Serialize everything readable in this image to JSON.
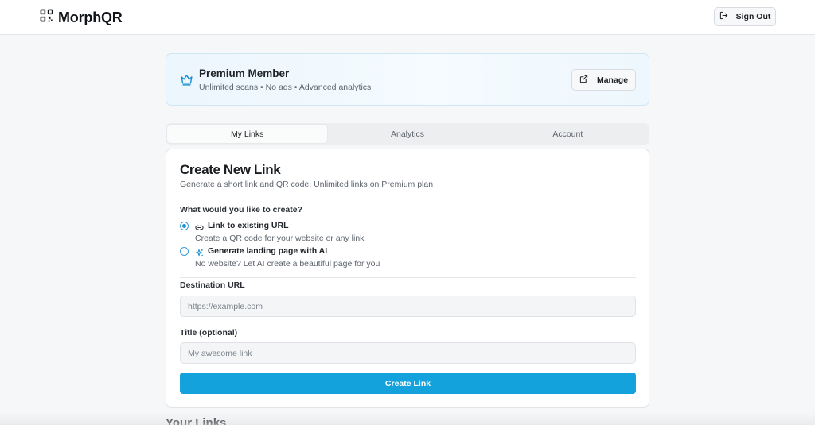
{
  "header": {
    "brand": "MorphQR",
    "brand_icon": "qr-code-icon",
    "signout_label": "Sign Out",
    "signout_icon": "log-out-icon"
  },
  "premium": {
    "title": "Premium Member",
    "subtitle": "Unlimited scans • No ads • Advanced analytics",
    "icon": "crown-icon",
    "manage_label": "Manage",
    "manage_icon": "external-link-icon",
    "accent_color": "#1b8fcf"
  },
  "tabs": [
    {
      "label": "My Links",
      "active": true
    },
    {
      "label": "Analytics",
      "active": false
    },
    {
      "label": "Account",
      "active": false
    }
  ],
  "form": {
    "title": "Create New Link",
    "subtitle": "Generate a short link and QR code. Unlimited links on Premium plan",
    "question": "What would you like to create?",
    "options": [
      {
        "label": "Link to existing URL",
        "description": "Create a QR code for your website or any link",
        "icon": "link-icon",
        "selected": true
      },
      {
        "label": "Generate landing page with AI",
        "description": "No website? Let AI create a beautiful page for you",
        "icon": "sparkles-icon",
        "selected": false
      }
    ],
    "destination": {
      "label": "Destination URL",
      "placeholder": "https://example.com",
      "value": ""
    },
    "title_field": {
      "label": "Title (optional)",
      "placeholder": "My awesome link",
      "value": ""
    },
    "submit_label": "Create Link",
    "submit_color": "#14a2dc"
  },
  "links_section": {
    "heading": "Your Links"
  }
}
